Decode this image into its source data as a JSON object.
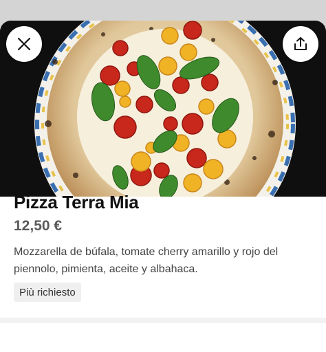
{
  "item": {
    "name": "Pizza Terra Mia",
    "price": "12,50 €",
    "description": "Mozzarella de búfala, tomate cherry amarillo y rojo del piennolo, pimienta, aceite y albahaca.",
    "badge": "Più richiesto"
  },
  "controls": {
    "close_icon": "close-icon",
    "share_icon": "share-icon"
  },
  "colors": {
    "title": "#111111",
    "price": "#5a5a5a",
    "badge_bg": "#efefef"
  }
}
